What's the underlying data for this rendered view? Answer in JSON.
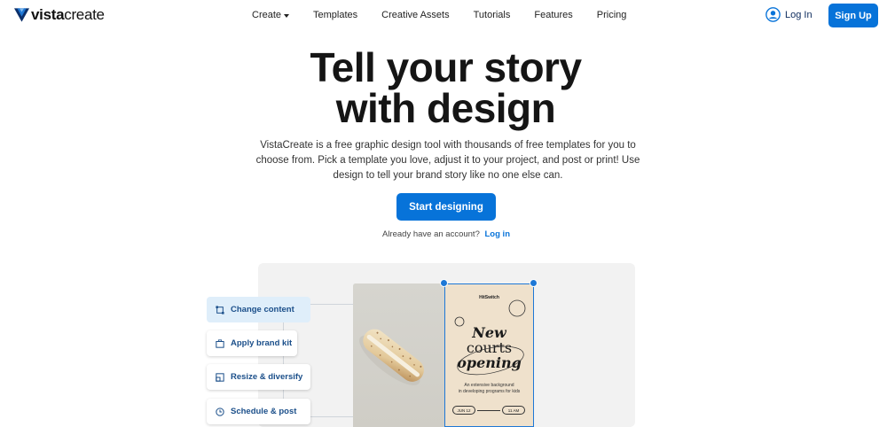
{
  "header": {
    "logo_bold": "vista",
    "logo_rest": "create",
    "nav": [
      {
        "label": "Create",
        "has_caret": true
      },
      {
        "label": "Templates"
      },
      {
        "label": "Creative Assets"
      },
      {
        "label": "Tutorials"
      },
      {
        "label": "Features"
      },
      {
        "label": "Pricing"
      }
    ],
    "login_label": "Log In",
    "signup_label": "Sign Up"
  },
  "hero": {
    "title_line1": "Tell your story",
    "title_line2": "with design",
    "description": "VistaCreate is a free graphic design tool with thousands of free templates for you to choose from. Pick a template you love, adjust it to your project, and post or print! Use design to tell your brand story like no one else can.",
    "cta_label": "Start designing",
    "account_question": "Already have an account?",
    "account_link": "Log in"
  },
  "features": [
    {
      "label": "Change content",
      "icon": "frame-icon",
      "active": true
    },
    {
      "label": "Apply brand kit",
      "icon": "briefcase-icon",
      "active": false
    },
    {
      "label": "Resize & diversify",
      "icon": "resize-icon",
      "active": false
    },
    {
      "label": "Schedule & post",
      "icon": "clock-icon",
      "active": false
    }
  ],
  "poster": {
    "brand": "HitSwitch",
    "headline_1": "New",
    "headline_2": "courts",
    "headline_3": "opening",
    "sub_1": "An extensive background",
    "sub_2": "in developing programs for kids",
    "date": "JUN 12",
    "time": "11 AM"
  },
  "colors": {
    "accent": "#0773d9",
    "poster_bg": "#efe1cc",
    "panel_bg": "#f2f2f2"
  }
}
